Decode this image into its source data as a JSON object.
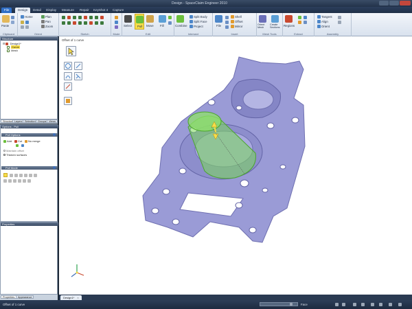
{
  "window": {
    "title": "Design - SpaceClaim Engineer 2010"
  },
  "menu": {
    "tabs": [
      "File",
      "Design",
      "Detail",
      "Display",
      "Measure",
      "Repair",
      "KeyShot 4",
      "Capture"
    ],
    "active": "Design"
  },
  "ribbon": {
    "clipboard": {
      "label": "Clipboard",
      "paste": "Paste"
    },
    "orient": {
      "label": "Orient",
      "home": "Home",
      "plan": "Plan",
      "pan": "Pan",
      "zoom": "Zoom"
    },
    "sketch": {
      "label": "Sketch"
    },
    "mode": {
      "label": "Mode"
    },
    "edit": {
      "label": "Edit",
      "select": "Select",
      "pull": "Pull",
      "move": "Move",
      "fill": "Fill"
    },
    "intersect": {
      "label": "Intersect",
      "combine": "Combine",
      "split_body": "Split Body",
      "split_face": "Split Face",
      "project": "Project"
    },
    "insert": {
      "label": "Insert",
      "file": "File",
      "shell": "Shell",
      "offset": "Offset",
      "mirror": "Mirror"
    },
    "mesh_tools": {
      "label": "Mesh Tools",
      "orient_mesh": "Orient Mesh",
      "create_sections": "Create Sections"
    },
    "extract": {
      "label": "Extract",
      "regions": "Regions"
    },
    "assembly": {
      "label": "Assembly",
      "tangent": "Tangent",
      "align": "Align",
      "orient": "Orient"
    }
  },
  "structure_panel": {
    "header": "Structure",
    "tree": [
      {
        "label": "Design1*",
        "level": 0
      },
      {
        "label": "Curve",
        "level": 1
      },
      {
        "label": "Mesh",
        "level": 1
      }
    ]
  },
  "panel_tabs": [
    "Structure",
    "Layers",
    "Selection",
    "Groups",
    "Views"
  ],
  "options_panel": {
    "header": "Options - Pull",
    "pull_options": "Pull Options",
    "add": "Add",
    "cut": "Cut",
    "no_merge": "No merge",
    "maintain_offset": "Maintain offset",
    "thicken_surfaces": "Thicken surfaces",
    "pull_mode": "Pull Mode"
  },
  "properties_panel": {
    "header": "Properties"
  },
  "bottom_tabs": [
    "Properties",
    "Appearance"
  ],
  "viewport": {
    "caption": "Offset of 1 curve"
  },
  "document_tab": "Design1*",
  "status": {
    "left": "Offset of 1 curve",
    "right": "Face"
  },
  "colors": {
    "model": "#9a9bd6",
    "highlight": "#7cd85a",
    "accent": "#f7dd4a"
  }
}
